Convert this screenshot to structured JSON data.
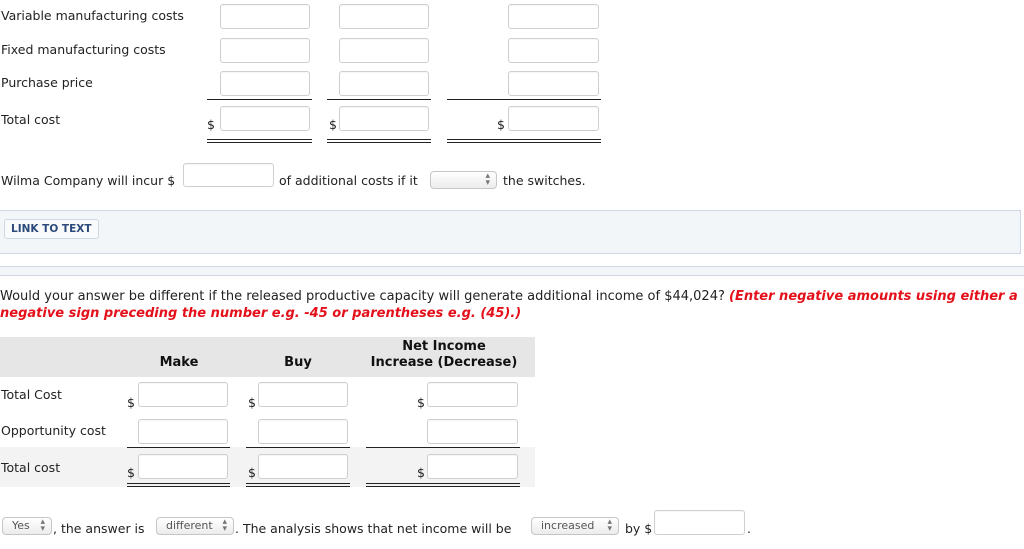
{
  "part1": {
    "rows": [
      {
        "label": "Variable manufacturing costs",
        "has_dollar": false
      },
      {
        "label": "Fixed manufacturing costs",
        "has_dollar": false
      },
      {
        "label": "Purchase price",
        "has_dollar": false
      },
      {
        "label": "Total cost",
        "has_dollar": true
      }
    ],
    "dollar_sign": "$",
    "inputs": {
      "values": [
        "",
        "",
        "",
        "",
        "",
        "",
        "",
        "",
        "",
        "",
        "",
        ""
      ]
    }
  },
  "sentence1": {
    "prefix": "Wilma Company will incur $",
    "amount_value": "",
    "middle": "of additional costs if it",
    "action_select": "",
    "suffix": "the switches."
  },
  "link_to_text": {
    "label": "LINK TO TEXT"
  },
  "question": {
    "text": "Would your answer be different if the released productive capacity will generate additional income of $44,024?",
    "instruction": "(Enter negative amounts using either a negative sign preceding the number e.g. -45 or parentheses e.g. (45).)"
  },
  "part2": {
    "headers": {
      "make": "Make",
      "buy": "Buy",
      "net_line1": "Net Income",
      "net_line2": "Increase (Decrease)"
    },
    "rows": [
      {
        "label": "Total Cost"
      },
      {
        "label": "Opportunity cost"
      },
      {
        "label": "Total cost"
      }
    ],
    "dollar_sign": "$"
  },
  "conclusion": {
    "answer_select": "Yes",
    "text1": ", the answer is",
    "diff_select": "different",
    "text2": ". The analysis shows that net income will be",
    "direction_select": "increased",
    "text3": "by $",
    "amount_value": "",
    "text4": "."
  },
  "icons": {
    "select_arrows": "⬍"
  }
}
